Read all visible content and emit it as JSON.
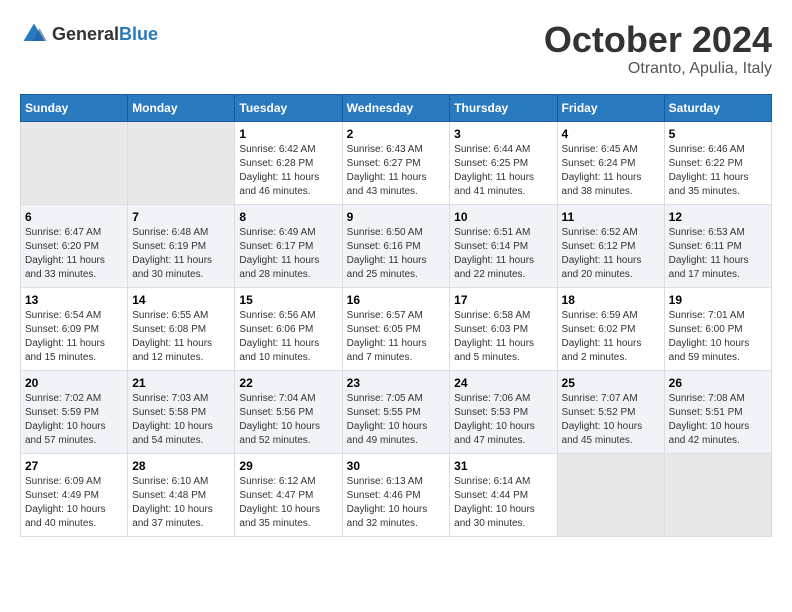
{
  "header": {
    "logo": {
      "general": "General",
      "blue": "Blue"
    },
    "month": "October 2024",
    "location": "Otranto, Apulia, Italy"
  },
  "days_of_week": [
    "Sunday",
    "Monday",
    "Tuesday",
    "Wednesday",
    "Thursday",
    "Friday",
    "Saturday"
  ],
  "weeks": [
    [
      {
        "day": null
      },
      {
        "day": null
      },
      {
        "day": "1",
        "sunrise": "6:42 AM",
        "sunset": "6:28 PM",
        "daylight": "11 hours and 46 minutes."
      },
      {
        "day": "2",
        "sunrise": "6:43 AM",
        "sunset": "6:27 PM",
        "daylight": "11 hours and 43 minutes."
      },
      {
        "day": "3",
        "sunrise": "6:44 AM",
        "sunset": "6:25 PM",
        "daylight": "11 hours and 41 minutes."
      },
      {
        "day": "4",
        "sunrise": "6:45 AM",
        "sunset": "6:24 PM",
        "daylight": "11 hours and 38 minutes."
      },
      {
        "day": "5",
        "sunrise": "6:46 AM",
        "sunset": "6:22 PM",
        "daylight": "11 hours and 35 minutes."
      }
    ],
    [
      {
        "day": "6",
        "sunrise": "6:47 AM",
        "sunset": "6:20 PM",
        "daylight": "11 hours and 33 minutes."
      },
      {
        "day": "7",
        "sunrise": "6:48 AM",
        "sunset": "6:19 PM",
        "daylight": "11 hours and 30 minutes."
      },
      {
        "day": "8",
        "sunrise": "6:49 AM",
        "sunset": "6:17 PM",
        "daylight": "11 hours and 28 minutes."
      },
      {
        "day": "9",
        "sunrise": "6:50 AM",
        "sunset": "6:16 PM",
        "daylight": "11 hours and 25 minutes."
      },
      {
        "day": "10",
        "sunrise": "6:51 AM",
        "sunset": "6:14 PM",
        "daylight": "11 hours and 22 minutes."
      },
      {
        "day": "11",
        "sunrise": "6:52 AM",
        "sunset": "6:12 PM",
        "daylight": "11 hours and 20 minutes."
      },
      {
        "day": "12",
        "sunrise": "6:53 AM",
        "sunset": "6:11 PM",
        "daylight": "11 hours and 17 minutes."
      }
    ],
    [
      {
        "day": "13",
        "sunrise": "6:54 AM",
        "sunset": "6:09 PM",
        "daylight": "11 hours and 15 minutes."
      },
      {
        "day": "14",
        "sunrise": "6:55 AM",
        "sunset": "6:08 PM",
        "daylight": "11 hours and 12 minutes."
      },
      {
        "day": "15",
        "sunrise": "6:56 AM",
        "sunset": "6:06 PM",
        "daylight": "11 hours and 10 minutes."
      },
      {
        "day": "16",
        "sunrise": "6:57 AM",
        "sunset": "6:05 PM",
        "daylight": "11 hours and 7 minutes."
      },
      {
        "day": "17",
        "sunrise": "6:58 AM",
        "sunset": "6:03 PM",
        "daylight": "11 hours and 5 minutes."
      },
      {
        "day": "18",
        "sunrise": "6:59 AM",
        "sunset": "6:02 PM",
        "daylight": "11 hours and 2 minutes."
      },
      {
        "day": "19",
        "sunrise": "7:01 AM",
        "sunset": "6:00 PM",
        "daylight": "10 hours and 59 minutes."
      }
    ],
    [
      {
        "day": "20",
        "sunrise": "7:02 AM",
        "sunset": "5:59 PM",
        "daylight": "10 hours and 57 minutes."
      },
      {
        "day": "21",
        "sunrise": "7:03 AM",
        "sunset": "5:58 PM",
        "daylight": "10 hours and 54 minutes."
      },
      {
        "day": "22",
        "sunrise": "7:04 AM",
        "sunset": "5:56 PM",
        "daylight": "10 hours and 52 minutes."
      },
      {
        "day": "23",
        "sunrise": "7:05 AM",
        "sunset": "5:55 PM",
        "daylight": "10 hours and 49 minutes."
      },
      {
        "day": "24",
        "sunrise": "7:06 AM",
        "sunset": "5:53 PM",
        "daylight": "10 hours and 47 minutes."
      },
      {
        "day": "25",
        "sunrise": "7:07 AM",
        "sunset": "5:52 PM",
        "daylight": "10 hours and 45 minutes."
      },
      {
        "day": "26",
        "sunrise": "7:08 AM",
        "sunset": "5:51 PM",
        "daylight": "10 hours and 42 minutes."
      }
    ],
    [
      {
        "day": "27",
        "sunrise": "6:09 AM",
        "sunset": "4:49 PM",
        "daylight": "10 hours and 40 minutes."
      },
      {
        "day": "28",
        "sunrise": "6:10 AM",
        "sunset": "4:48 PM",
        "daylight": "10 hours and 37 minutes."
      },
      {
        "day": "29",
        "sunrise": "6:12 AM",
        "sunset": "4:47 PM",
        "daylight": "10 hours and 35 minutes."
      },
      {
        "day": "30",
        "sunrise": "6:13 AM",
        "sunset": "4:46 PM",
        "daylight": "10 hours and 32 minutes."
      },
      {
        "day": "31",
        "sunrise": "6:14 AM",
        "sunset": "4:44 PM",
        "daylight": "10 hours and 30 minutes."
      },
      {
        "day": null
      },
      {
        "day": null
      }
    ]
  ],
  "labels": {
    "sunrise": "Sunrise:",
    "sunset": "Sunset:",
    "daylight": "Daylight:"
  }
}
